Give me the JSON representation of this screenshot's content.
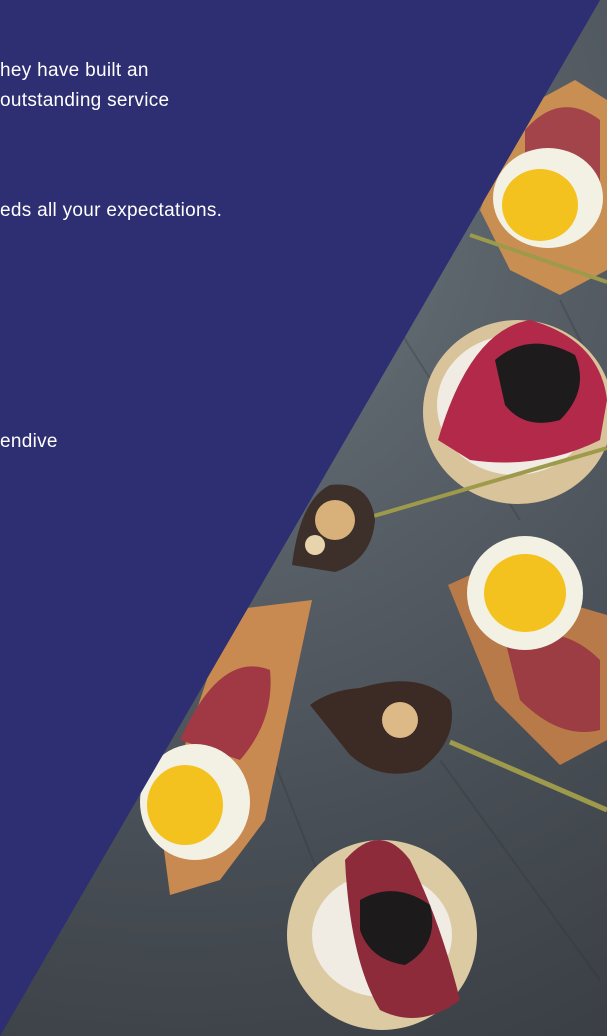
{
  "content": {
    "lines": [
      "hey have built an",
      "outstanding service",
      "eds all your expectations.",
      "endive"
    ]
  },
  "colors": {
    "panel_background": "#2e2e72",
    "text": "#ffffff",
    "slate_surface": "#4f565d"
  },
  "image": {
    "icon_name": "food-photo-canapes"
  }
}
